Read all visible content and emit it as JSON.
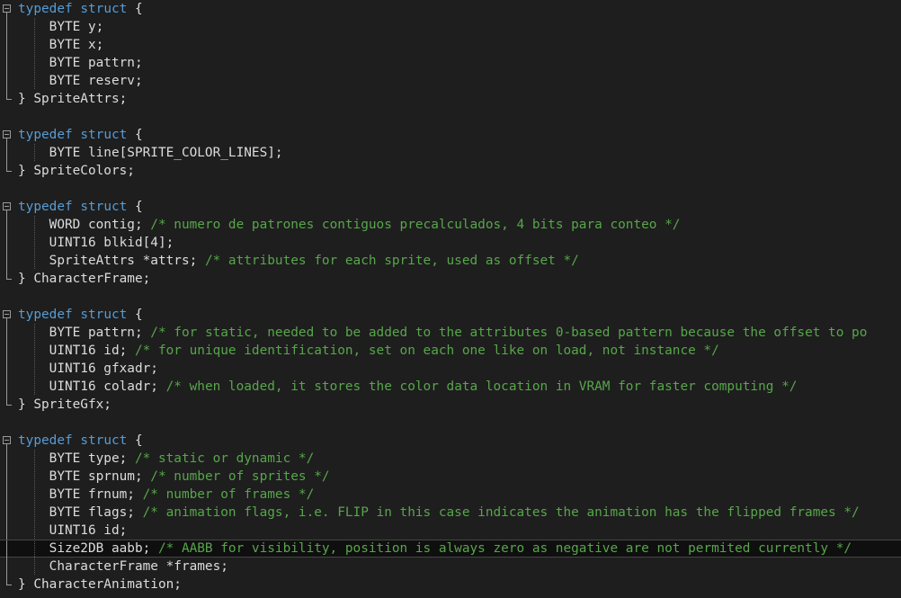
{
  "editor": {
    "lines": [
      {
        "fold": "start",
        "guide": false,
        "current": false,
        "tokens": [
          {
            "type": "kw",
            "text": "typedef"
          },
          {
            "type": "text",
            "text": " "
          },
          {
            "type": "kw",
            "text": "struct"
          },
          {
            "type": "text",
            "text": " {"
          }
        ]
      },
      {
        "fold": "inner",
        "guide": true,
        "current": false,
        "tokens": [
          {
            "type": "text",
            "text": "    BYTE y;"
          }
        ]
      },
      {
        "fold": "inner",
        "guide": true,
        "current": false,
        "tokens": [
          {
            "type": "text",
            "text": "    BYTE x;"
          }
        ]
      },
      {
        "fold": "inner",
        "guide": true,
        "current": false,
        "tokens": [
          {
            "type": "text",
            "text": "    BYTE pattrn;"
          }
        ]
      },
      {
        "fold": "inner",
        "guide": true,
        "current": false,
        "tokens": [
          {
            "type": "text",
            "text": "    BYTE reserv;"
          }
        ]
      },
      {
        "fold": "end",
        "guide": false,
        "current": false,
        "tokens": [
          {
            "type": "text",
            "text": "} SpriteAttrs;"
          }
        ]
      },
      {
        "fold": "none",
        "guide": false,
        "current": false,
        "tokens": []
      },
      {
        "fold": "start",
        "guide": false,
        "current": false,
        "tokens": [
          {
            "type": "kw",
            "text": "typedef"
          },
          {
            "type": "text",
            "text": " "
          },
          {
            "type": "kw",
            "text": "struct"
          },
          {
            "type": "text",
            "text": " {"
          }
        ]
      },
      {
        "fold": "inner",
        "guide": true,
        "current": false,
        "tokens": [
          {
            "type": "text",
            "text": "    BYTE line[SPRITE_COLOR_LINES];"
          }
        ]
      },
      {
        "fold": "end",
        "guide": false,
        "current": false,
        "tokens": [
          {
            "type": "text",
            "text": "} SpriteColors;"
          }
        ]
      },
      {
        "fold": "none",
        "guide": false,
        "current": false,
        "tokens": []
      },
      {
        "fold": "start",
        "guide": false,
        "current": false,
        "tokens": [
          {
            "type": "kw",
            "text": "typedef"
          },
          {
            "type": "text",
            "text": " "
          },
          {
            "type": "kw",
            "text": "struct"
          },
          {
            "type": "text",
            "text": " {"
          }
        ]
      },
      {
        "fold": "inner",
        "guide": true,
        "current": false,
        "tokens": [
          {
            "type": "text",
            "text": "    WORD contig; "
          },
          {
            "type": "comment",
            "text": "/* numero de patrones contiguos precalculados, 4 bits para conteo */"
          }
        ]
      },
      {
        "fold": "inner",
        "guide": true,
        "current": false,
        "tokens": [
          {
            "type": "text",
            "text": "    UINT16 blkid[4];"
          }
        ]
      },
      {
        "fold": "inner",
        "guide": true,
        "current": false,
        "tokens": [
          {
            "type": "text",
            "text": "    SpriteAttrs *attrs; "
          },
          {
            "type": "comment",
            "text": "/* attributes for each sprite, used as offset */"
          }
        ]
      },
      {
        "fold": "end",
        "guide": false,
        "current": false,
        "tokens": [
          {
            "type": "text",
            "text": "} CharacterFrame;"
          }
        ]
      },
      {
        "fold": "none",
        "guide": false,
        "current": false,
        "tokens": []
      },
      {
        "fold": "start",
        "guide": false,
        "current": false,
        "tokens": [
          {
            "type": "kw",
            "text": "typedef"
          },
          {
            "type": "text",
            "text": " "
          },
          {
            "type": "kw",
            "text": "struct"
          },
          {
            "type": "text",
            "text": " {"
          }
        ]
      },
      {
        "fold": "inner",
        "guide": true,
        "current": false,
        "tokens": [
          {
            "type": "text",
            "text": "    BYTE pattrn; "
          },
          {
            "type": "comment",
            "text": "/* for static, needed to be added to the attributes 0-based pattern because the offset to po"
          }
        ]
      },
      {
        "fold": "inner",
        "guide": true,
        "current": false,
        "tokens": [
          {
            "type": "text",
            "text": "    UINT16 id; "
          },
          {
            "type": "comment",
            "text": "/* for unique identification, set on each one like on load, not instance */"
          }
        ]
      },
      {
        "fold": "inner",
        "guide": true,
        "current": false,
        "tokens": [
          {
            "type": "text",
            "text": "    UINT16 gfxadr;"
          }
        ]
      },
      {
        "fold": "inner",
        "guide": true,
        "current": false,
        "tokens": [
          {
            "type": "text",
            "text": "    UINT16 coladr; "
          },
          {
            "type": "comment",
            "text": "/* when loaded, it stores the color data location in VRAM for faster computing */"
          }
        ]
      },
      {
        "fold": "end",
        "guide": false,
        "current": false,
        "tokens": [
          {
            "type": "text",
            "text": "} SpriteGfx;"
          }
        ]
      },
      {
        "fold": "none",
        "guide": false,
        "current": false,
        "tokens": []
      },
      {
        "fold": "start",
        "guide": false,
        "current": false,
        "tokens": [
          {
            "type": "kw",
            "text": "typedef"
          },
          {
            "type": "text",
            "text": " "
          },
          {
            "type": "kw",
            "text": "struct"
          },
          {
            "type": "text",
            "text": " {"
          }
        ]
      },
      {
        "fold": "inner",
        "guide": true,
        "current": false,
        "tokens": [
          {
            "type": "text",
            "text": "    BYTE type; "
          },
          {
            "type": "comment",
            "text": "/* static or dynamic */"
          }
        ]
      },
      {
        "fold": "inner",
        "guide": true,
        "current": false,
        "tokens": [
          {
            "type": "text",
            "text": "    BYTE sprnum; "
          },
          {
            "type": "comment",
            "text": "/* number of sprites */"
          }
        ]
      },
      {
        "fold": "inner",
        "guide": true,
        "current": false,
        "tokens": [
          {
            "type": "text",
            "text": "    BYTE frnum; "
          },
          {
            "type": "comment",
            "text": "/* number of frames */"
          }
        ]
      },
      {
        "fold": "inner",
        "guide": true,
        "current": false,
        "tokens": [
          {
            "type": "text",
            "text": "    BYTE flags; "
          },
          {
            "type": "comment",
            "text": "/* animation flags, i.e. FLIP in this case indicates the animation has the flipped frames */"
          }
        ]
      },
      {
        "fold": "inner",
        "guide": true,
        "current": false,
        "tokens": [
          {
            "type": "text",
            "text": "    UINT16 id;"
          }
        ]
      },
      {
        "fold": "inner",
        "guide": true,
        "current": true,
        "tokens": [
          {
            "type": "text",
            "text": "    Size2DB aabb; "
          },
          {
            "type": "comment",
            "text": "/* AABB for visibility, position is always zero as negative are not permited currently */"
          }
        ]
      },
      {
        "fold": "inner",
        "guide": true,
        "current": false,
        "tokens": [
          {
            "type": "text",
            "text": "    CharacterFrame *frames;"
          }
        ]
      },
      {
        "fold": "end",
        "guide": false,
        "current": false,
        "tokens": [
          {
            "type": "text",
            "text": "} CharacterAnimation;"
          }
        ]
      }
    ]
  },
  "colors": {
    "background": "#1e1e1e",
    "keyword": "#569cd6",
    "text": "#dcdcdc",
    "comment": "#57a64a",
    "current_line": "#0f0f0f"
  },
  "icons": {
    "fold_start": "collapse-minus-icon",
    "fold_end": "fold-end-corner-icon"
  }
}
